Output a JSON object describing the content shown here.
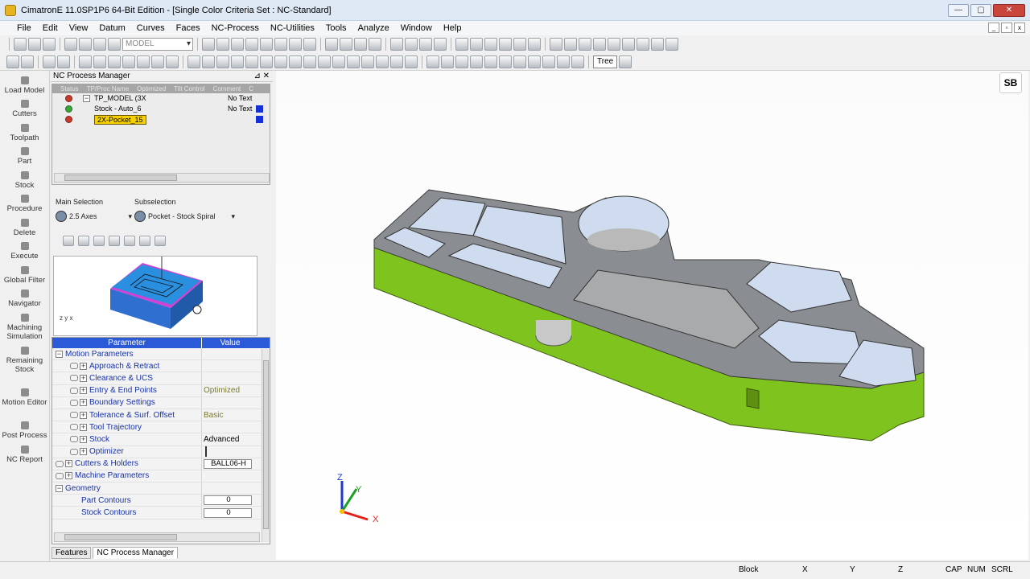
{
  "window": {
    "title": "CimatronE 11.0SP1P6 64-Bit Edition - [Single Color Criteria Set : NC-Standard]"
  },
  "menu": [
    "File",
    "Edit",
    "View",
    "Datum",
    "Curves",
    "Faces",
    "NC-Process",
    "NC-Utilities",
    "Tools",
    "Analyze",
    "Window",
    "Help"
  ],
  "toolbar": {
    "model_combo": "MODEL",
    "tree_label": "Tree"
  },
  "left_tools": [
    {
      "label": "Load Model"
    },
    {
      "label": "Cutters"
    },
    {
      "label": "Toolpath"
    },
    {
      "label": "Part"
    },
    {
      "label": "Stock"
    },
    {
      "label": "Procedure"
    },
    {
      "label": "Delete"
    },
    {
      "label": "Execute"
    },
    {
      "label": "Global Filter"
    },
    {
      "label": "Navigator"
    },
    {
      "label": "Machining Simulation"
    },
    {
      "label": "Remaining Stock"
    },
    {
      "label": "Motion Editor"
    },
    {
      "label": "Post Process"
    },
    {
      "label": "NC Report"
    }
  ],
  "nc_panel": {
    "title": "NC Process Manager",
    "columns": [
      "Status",
      "TP/Proc Name",
      "Optimized",
      "Tilt Control",
      "Comment",
      "C"
    ],
    "rows": [
      {
        "status": "error",
        "name": "TP_MODEL (3X",
        "comment": "No Text",
        "color": ""
      },
      {
        "status": "ok",
        "name": "Stock - Auto_6",
        "comment": "No Text",
        "color": "#1630d8"
      },
      {
        "status": "error",
        "name": "2X-Pocket_15",
        "comment": "",
        "color": "#1630d8"
      }
    ]
  },
  "selection": {
    "main_label": "Main Selection",
    "main_value": "2.5 Axes",
    "sub_label": "Subselection",
    "sub_value": "Pocket - Stock Spiral"
  },
  "params": {
    "header_param": "Parameter",
    "header_value": "Value",
    "rows": [
      {
        "name": "Motion Parameters",
        "value": "",
        "indent": 0,
        "expander": "−",
        "link": false,
        "kind": "text"
      },
      {
        "name": "Approach & Retract",
        "value": "",
        "indent": 1,
        "expander": "+",
        "link": true,
        "kind": "text"
      },
      {
        "name": "Clearance & UCS",
        "value": "",
        "indent": 1,
        "expander": "+",
        "link": true,
        "kind": "text"
      },
      {
        "name": "Entry & End Points",
        "value": "Optimized",
        "indent": 1,
        "expander": "+",
        "link": true,
        "kind": "text"
      },
      {
        "name": "Boundary Settings",
        "value": "",
        "indent": 1,
        "expander": "+",
        "link": true,
        "kind": "text"
      },
      {
        "name": "Tolerance & Surf. Offset",
        "value": "Basic",
        "indent": 1,
        "expander": "+",
        "link": true,
        "kind": "text"
      },
      {
        "name": "Tool Trajectory",
        "value": "",
        "indent": 1,
        "expander": "+",
        "link": true,
        "kind": "text"
      },
      {
        "name": "Stock",
        "value": "Advanced",
        "indent": 1,
        "expander": "+",
        "link": true,
        "kind": "text"
      },
      {
        "name": "Optimizer",
        "value": "",
        "indent": 1,
        "expander": "+",
        "link": true,
        "kind": "check"
      },
      {
        "name": "Cutters & Holders",
        "value": "BALL06-H",
        "indent": 0,
        "expander": "+",
        "link": true,
        "kind": "box"
      },
      {
        "name": "Machine Parameters",
        "value": "",
        "indent": 0,
        "expander": "+",
        "link": true,
        "kind": "text"
      },
      {
        "name": "Geometry",
        "value": "",
        "indent": 0,
        "expander": "−",
        "link": false,
        "kind": "text"
      },
      {
        "name": "Part Contours",
        "value": "0",
        "indent": 2,
        "expander": "",
        "link": false,
        "kind": "box"
      },
      {
        "name": "Stock Contours",
        "value": "0",
        "indent": 2,
        "expander": "",
        "link": false,
        "kind": "box"
      }
    ]
  },
  "tabs": [
    {
      "label": "Features",
      "active": false
    },
    {
      "label": "NC Process Manager",
      "active": true
    }
  ],
  "viewport": {
    "logo": "SB",
    "axis_x": "X",
    "axis_y": "Y",
    "axis_z": "Z"
  },
  "preview_axes": "z y x",
  "status": {
    "block": "Block",
    "x": "X",
    "y": "Y",
    "z": "Z",
    "cap": "CAP",
    "num": "NUM",
    "scrl": "SCRL"
  }
}
